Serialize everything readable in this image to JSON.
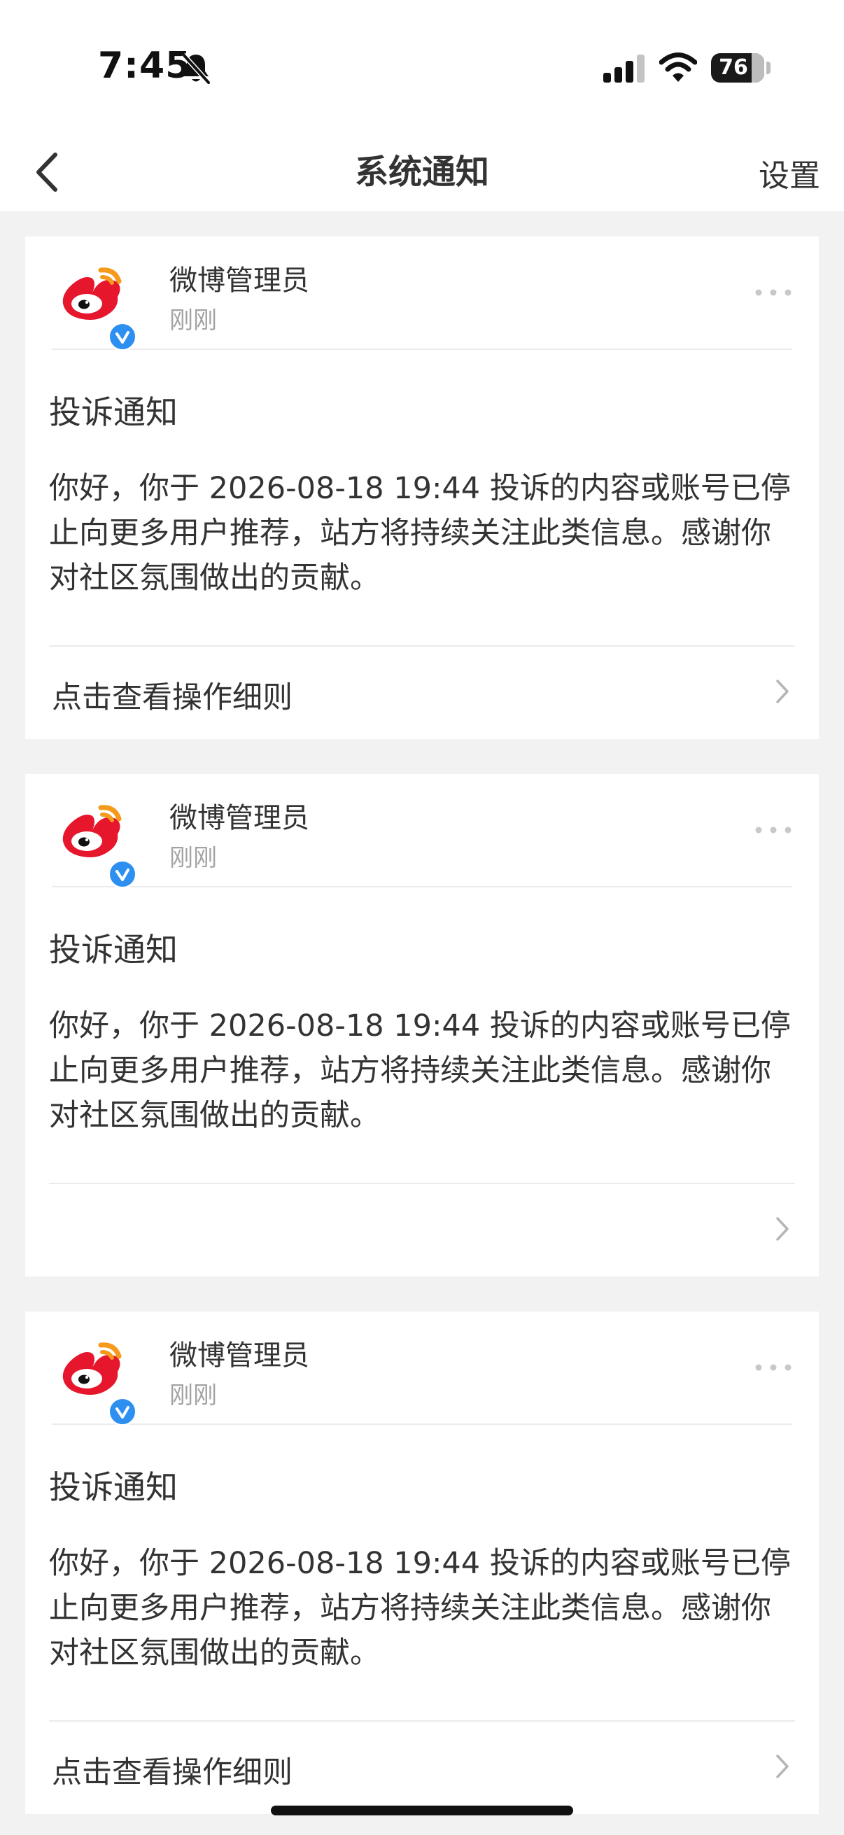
{
  "status_bar": {
    "time": "7:45",
    "battery_level": "76",
    "icons": [
      "bell-slash-icon",
      "cellular-signal-icon",
      "wifi-icon",
      "battery-icon"
    ]
  },
  "nav": {
    "back_icon": "chevron-left-icon",
    "title": "系统通知",
    "settings_label": "设置"
  },
  "notifications": [
    {
      "sender": "微博管理员",
      "time": "刚刚",
      "title": "投诉通知",
      "body": "你好，你于 2026-08-18 19:44 投诉的内容或账号已停止向更多用户推荐，站方将持续关注此类信息。感谢你对社区氛围做出的贡献。",
      "link_label": "点击查看操作细则"
    },
    {
      "sender": "微博管理员",
      "time": "刚刚",
      "title": "投诉通知",
      "body": "你好，你于 2026-08-18 19:44 投诉的内容或账号已停止向更多用户推荐，站方将持续关注此类信息。感谢你对社区氛围做出的贡献。",
      "link_label": ""
    },
    {
      "sender": "微博管理员",
      "time": "刚刚",
      "title": "投诉通知",
      "body": "你好，你于 2026-08-18 19:44 投诉的内容或账号已停止向更多用户推荐，站方将持续关注此类信息。感谢你对社区氛围做出的贡献。",
      "link_label": "点击查看操作细则"
    }
  ],
  "colors": {
    "background": "#f2f2f2",
    "card": "#ffffff",
    "text": "#333333",
    "secondary_text": "#a3a3a3",
    "verified_badge": "#2d8ff0",
    "weibo_red": "#e6162d",
    "weibo_orange": "#f59a1b"
  }
}
